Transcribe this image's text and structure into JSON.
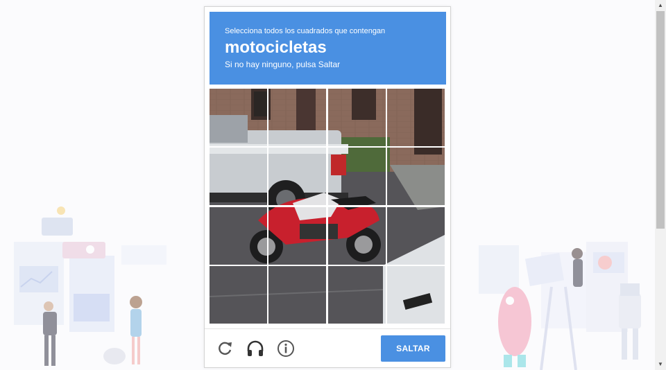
{
  "captcha": {
    "instruction": "Selecciona todos los cuadrados que contengan",
    "keyword": "motocicletas",
    "hint": "Si no hay ninguno, pulsa Saltar",
    "header_color": "#4a90e2",
    "grid": {
      "rows": 4,
      "columns": 4
    },
    "footer": {
      "reload_icon": "reload-icon",
      "audio_icon": "headphones-icon",
      "info_icon": "info-icon",
      "skip_label": "SALTAR"
    }
  }
}
